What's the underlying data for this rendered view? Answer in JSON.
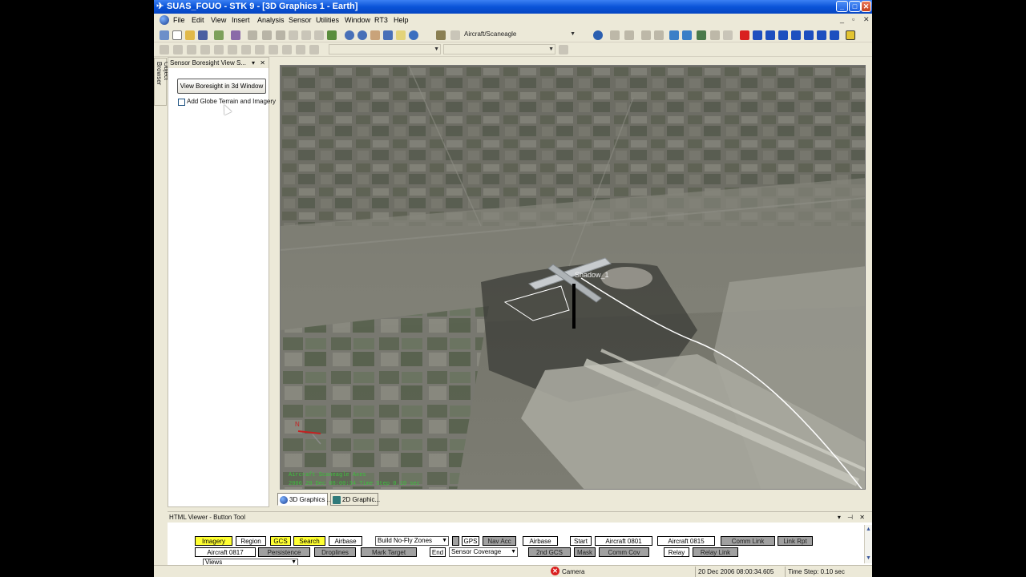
{
  "window": {
    "title": "SUAS_FOUO - STK 9 - [3D Graphics 1 - Earth]",
    "controls": {
      "minimize": "_",
      "maximize": "□",
      "close": "✕"
    }
  },
  "menu": {
    "items": [
      "File",
      "Edit",
      "View",
      "Insert",
      "Analysis",
      "Sensor",
      "Utilities",
      "Window",
      "RT3",
      "Help"
    ],
    "mdi_controls": {
      "minimize": "_",
      "restore": "▫",
      "close": "✕"
    }
  },
  "toolbar": {
    "object_selector": "Aircraft/Scaneagle"
  },
  "left_panel": {
    "side_tab": "Object Browser",
    "title": "Sensor Boresight View S...",
    "view_button": "View Boresight in 3d Window",
    "terrain_label": "Add Globe Terrain and Imagery",
    "terrain_checked": false
  },
  "view3d": {
    "object_label": "Shadow_1",
    "overlay_line1": "Aircraft Scaneagle Axes",
    "overlay_line2": "2006 20 Dec 08:00:34  Time Step 0.10 sec",
    "compass_letter": "N"
  },
  "mdi_tabs": [
    {
      "label": "3D Graphics ...",
      "icon": "globe-icon",
      "active": true
    },
    {
      "label": "2D Graphic...",
      "icon": "map-icon",
      "active": false
    }
  ],
  "html_viewer": {
    "title": "HTML Viewer - Button Tool",
    "row1": [
      {
        "label": "Imagery",
        "style": "yellow"
      },
      {
        "label": "Region",
        "style": "white"
      },
      {
        "label": "GCS",
        "style": "yellow"
      },
      {
        "label": "Search",
        "style": "yellow"
      },
      {
        "label": "Airbase",
        "style": "white"
      },
      {
        "label": "Build No-Fly Zones",
        "style": "dropdown"
      },
      {
        "label": "GPS",
        "style": "white"
      },
      {
        "label": "Nav Acc",
        "style": "gray"
      },
      {
        "label": "Airbase",
        "style": "white"
      },
      {
        "label": "Start",
        "style": "white"
      },
      {
        "label": "Aircraft 0801",
        "style": "white"
      },
      {
        "label": "Aircraft 0815",
        "style": "white"
      },
      {
        "label": "Comm Link",
        "style": "gray"
      },
      {
        "label": "Link Rpt",
        "style": "gray"
      }
    ],
    "row2": [
      {
        "label": "Aircraft 0817",
        "style": "white"
      },
      {
        "label": "Persistence",
        "style": "gray"
      },
      {
        "label": "Droplines",
        "style": "gray"
      },
      {
        "label": "Mark Target",
        "style": "gray"
      },
      {
        "label": "End",
        "style": "white"
      },
      {
        "label": "Sensor Coverage",
        "style": "dropdown"
      },
      {
        "label": "2nd GCS",
        "style": "gray"
      },
      {
        "label": "Mask",
        "style": "gray"
      },
      {
        "label": "Comm Cov",
        "style": "gray"
      },
      {
        "label": "Relay",
        "style": "white"
      },
      {
        "label": "Relay Link",
        "style": "gray"
      }
    ],
    "row3_dropdown": "Views"
  },
  "status_bar": {
    "camera": "Camera",
    "datetime": "20 Dec 2006 08:00:34.605",
    "time_step": "Time Step: 0.10 sec"
  },
  "colors": {
    "titlebar": "#0a54d8",
    "yellow_button": "#ffff33",
    "gray_button": "#a0a0a0",
    "overlay_text": "#3fbf3f"
  }
}
